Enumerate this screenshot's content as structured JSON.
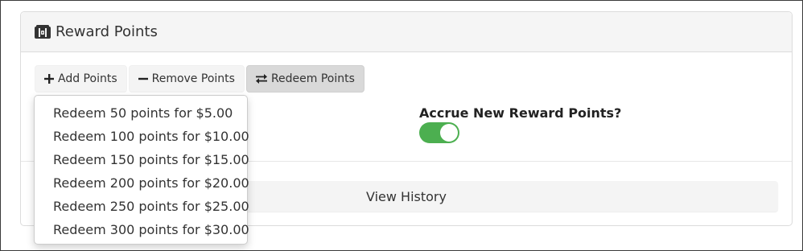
{
  "panel": {
    "title": "Reward Points",
    "icon": "treasure-chest-icon"
  },
  "toolbar": {
    "add_label": "Add Points",
    "remove_label": "Remove Points",
    "redeem_label": "Redeem Points"
  },
  "settings": {
    "accrue_label": "Accrue New Reward Points?",
    "accrue_enabled": true,
    "toggle_color": "#4caf50"
  },
  "history_button": "View History",
  "redeem_menu": {
    "items": [
      "Redeem 50 points for $5.00",
      "Redeem 100 points for $10.00",
      "Redeem 150 points for $15.00",
      "Redeem 200 points for $20.00",
      "Redeem 250 points for $25.00",
      "Redeem 300 points for $30.00"
    ]
  }
}
